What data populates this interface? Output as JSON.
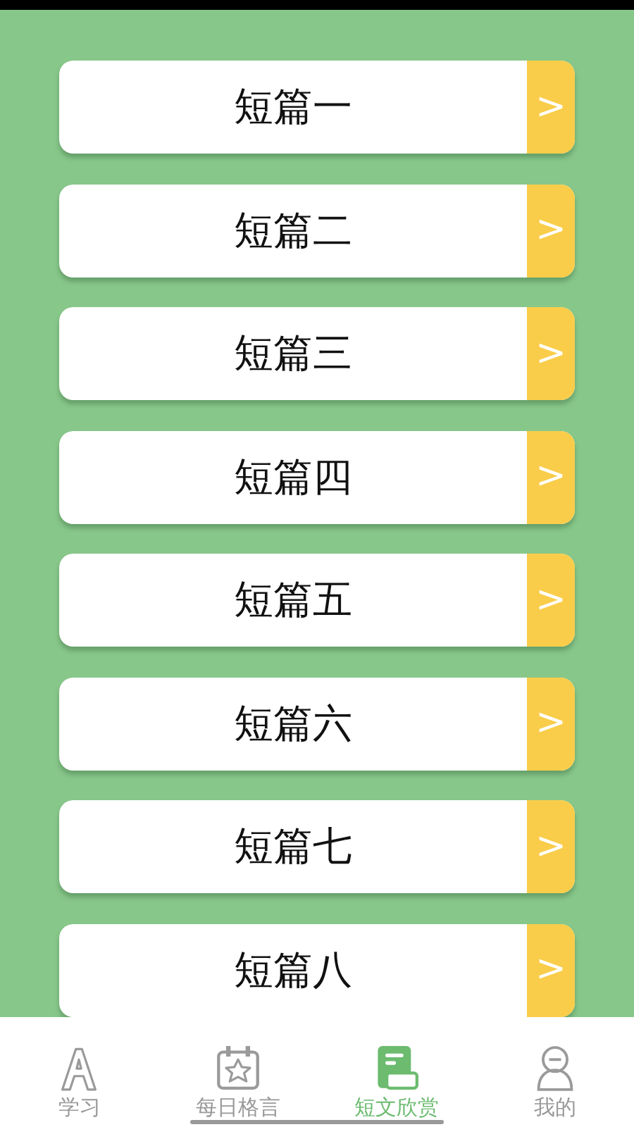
{
  "items": [
    {
      "title": "短篇一",
      "arrow": ">"
    },
    {
      "title": "短篇二",
      "arrow": ">"
    },
    {
      "title": "短篇三",
      "arrow": ">"
    },
    {
      "title": "短篇四",
      "arrow": ">"
    },
    {
      "title": "短篇五",
      "arrow": ">"
    },
    {
      "title": "短篇六",
      "arrow": ">"
    },
    {
      "title": "短篇七",
      "arrow": ">"
    },
    {
      "title": "短篇八",
      "arrow": ">"
    }
  ],
  "tabs": [
    {
      "label": "学习",
      "kind": "letter",
      "selected": false
    },
    {
      "label": "每日格言",
      "kind": "calendar",
      "selected": false
    },
    {
      "label": "短文欣赏",
      "kind": "book",
      "selected": true
    },
    {
      "label": "我的",
      "kind": "person",
      "selected": false
    }
  ]
}
